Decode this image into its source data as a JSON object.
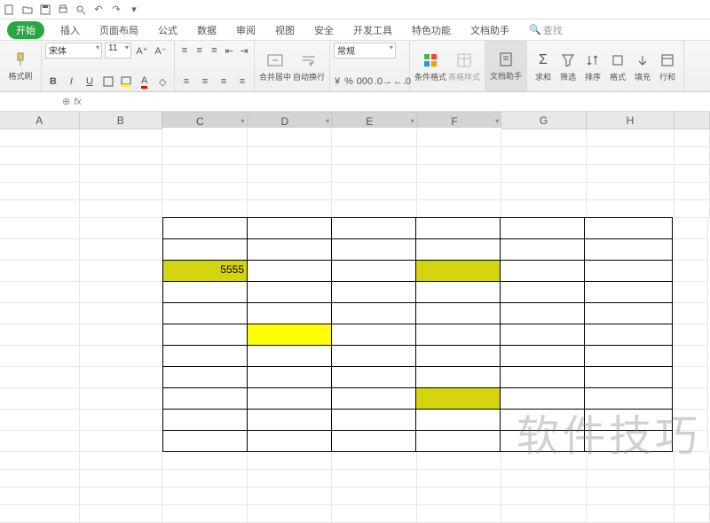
{
  "qat_icons": [
    "file",
    "folder",
    "save",
    "print",
    "preview",
    "undo",
    "redo",
    "dropdown"
  ],
  "tabs": {
    "items": [
      "开始",
      "插入",
      "页面布局",
      "公式",
      "数据",
      "审阅",
      "视图",
      "安全",
      "开发工具",
      "特色功能",
      "文档助手"
    ],
    "active_index": 0,
    "search_label": "查找"
  },
  "ribbon": {
    "paste_label": "格式刷",
    "font_name": "宋体",
    "font_size": "11",
    "bold": "B",
    "italic": "I",
    "underline": "U",
    "merge_label": "合并居中",
    "wrap_label": "自动换行",
    "number_format": "常规",
    "cond_fmt": "条件格式",
    "table_fmt": "表格样式",
    "doc_helper": "文档助手",
    "sum": "求和",
    "filter": "筛选",
    "sort": "排序",
    "format": "格式",
    "fill": "填充",
    "rowcol": "行和"
  },
  "formula_bar": {
    "name": "",
    "fx": "fx",
    "value": ""
  },
  "columns": [
    "A",
    "B",
    "C",
    "D",
    "E",
    "F",
    "G",
    "H",
    ""
  ],
  "selected_col_range": [
    2,
    6
  ],
  "table": {
    "row_start": 6,
    "row_end": 16,
    "col_start": 2,
    "col_end": 7
  },
  "cells": {
    "C8": {
      "value": "5555",
      "fill": "ylw"
    },
    "F8": {
      "value": "",
      "fill": "ylw"
    },
    "D11": {
      "value": "",
      "fill": "ylw2"
    },
    "F14": {
      "value": "",
      "fill": "ylw"
    }
  },
  "watermark": "软件技巧",
  "chart_data": {
    "type": "table",
    "columns": [
      "A",
      "B",
      "C",
      "D",
      "E",
      "F",
      "G",
      "H"
    ],
    "highlighted_cells": [
      {
        "cell": "C8",
        "value": 5555,
        "color": "#d4d40f"
      },
      {
        "cell": "F8",
        "value": null,
        "color": "#d4d40f"
      },
      {
        "cell": "D11",
        "value": null,
        "color": "#ffff00"
      },
      {
        "cell": "F14",
        "value": null,
        "color": "#d4d40f"
      }
    ],
    "bordered_range": "C6:H16"
  }
}
